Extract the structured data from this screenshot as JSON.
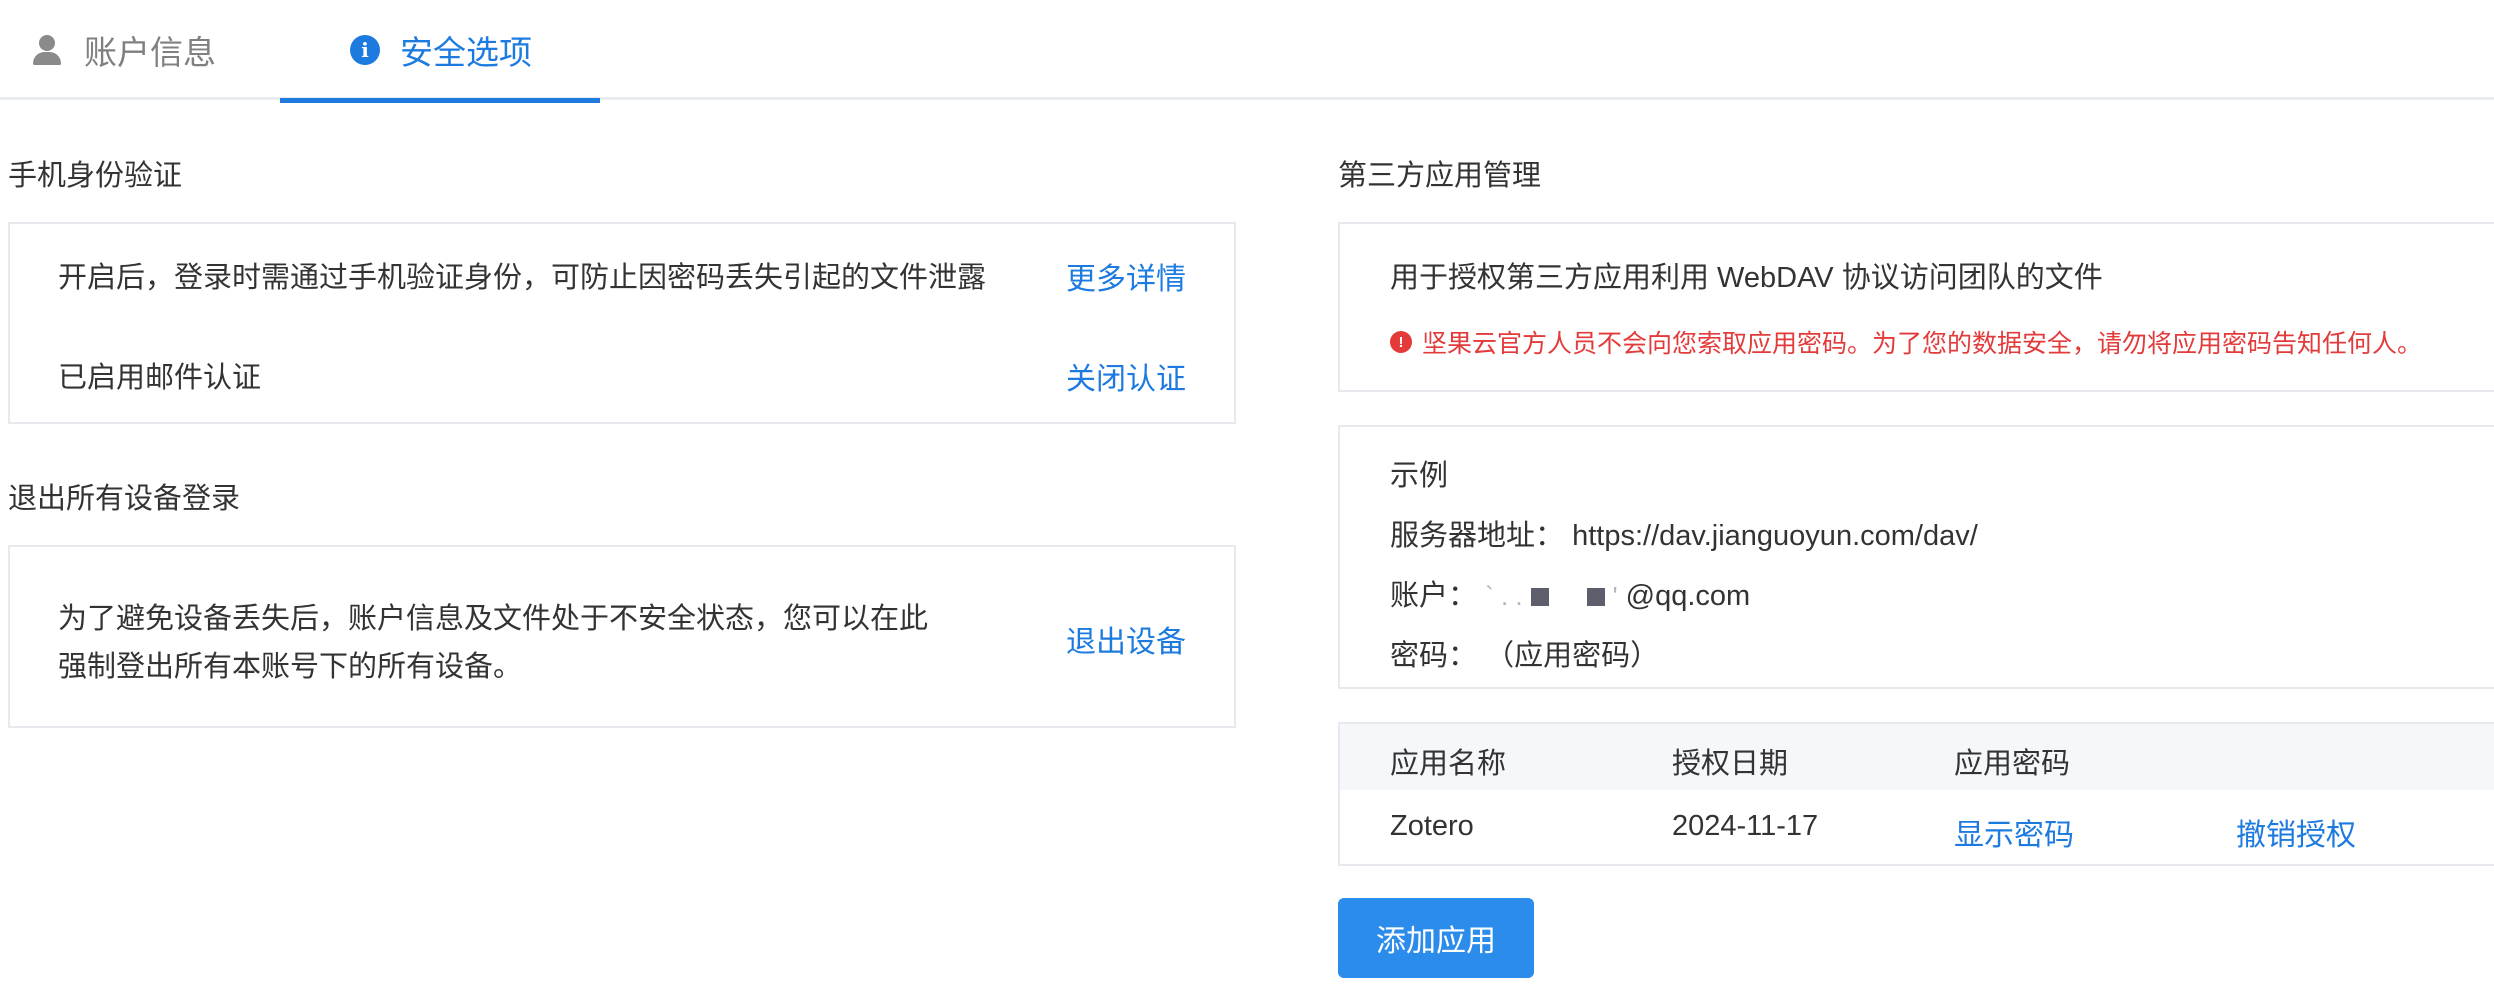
{
  "tabs": {
    "account_label": "账户信息",
    "security_label": "安全选项"
  },
  "phone_verification": {
    "title": "手机身份验证",
    "description": "开启后，登录时需通过手机验证身份，可防止因密码丢失引起的文件泄露",
    "more_link": "更多详情",
    "status_text": "已启用邮件认证",
    "disable_link": "关闭认证"
  },
  "logout_all": {
    "title": "退出所有设备登录",
    "description_line1": "为了避免设备丢失后，账户信息及文件处于不安全状态，您可以在此",
    "description_line2": "强制登出所有本账号下的所有设备。",
    "logout_link": "退出设备"
  },
  "third_party": {
    "title": "第三方应用管理",
    "description": "用于授权第三方应用利用 WebDAV 协议访问团队的文件",
    "warning": "坚果云官方人员不会向您索取应用密码。为了您的数据安全，请勿将应用密码告知任何人。"
  },
  "example": {
    "title": "示例",
    "server_label": "服务器地址：",
    "server_value": "https://dav.jianguoyun.com/dav/",
    "account_label": "账户：",
    "account_suffix": "@qq.com",
    "password_label": "密码：",
    "password_value": "（应用密码）"
  },
  "apps_table": {
    "headers": [
      "应用名称",
      "授权日期",
      "应用密码"
    ],
    "rows": [
      {
        "name": "Zotero",
        "date": "2024-11-17",
        "show_password": "显示密码",
        "revoke": "撤销授权"
      }
    ]
  },
  "add_app_button": "添加应用",
  "colors": {
    "accent": "#1d7be0",
    "button": "#2b8ceb",
    "warning": "#e33a3a",
    "border": "#e6e9ee",
    "table_header_bg": "#f5f7fa"
  },
  "icons": {
    "account_tab": "person-icon",
    "security_tab": "info-icon",
    "warning": "warning-icon"
  }
}
